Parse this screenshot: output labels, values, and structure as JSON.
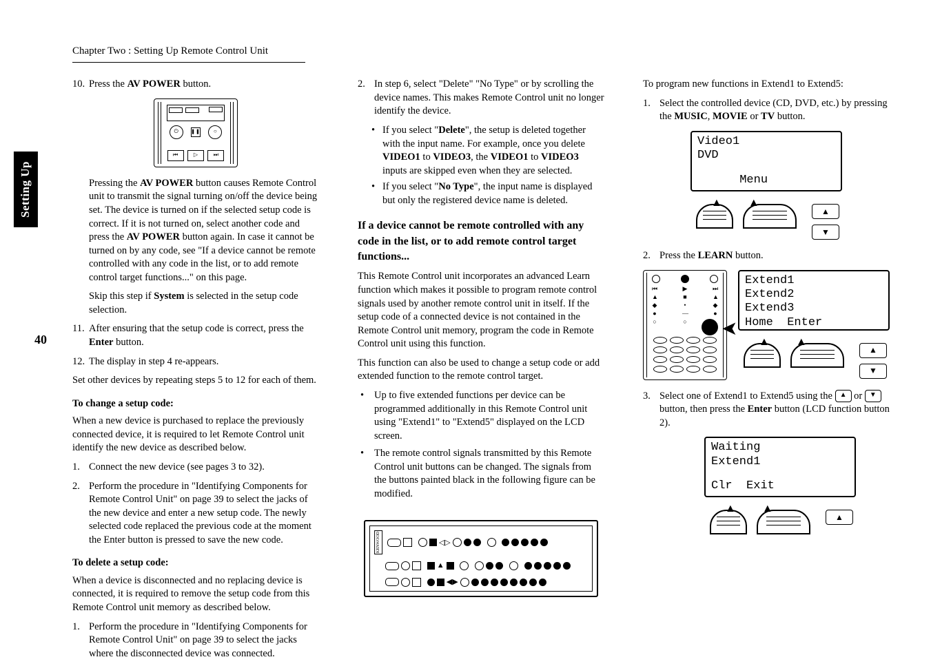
{
  "side_tab": "Setting Up",
  "chapter_header": "Chapter Two : Setting Up Remote Control Unit",
  "page_number": "40",
  "col1": {
    "step10_num": "10.",
    "step10_text_a": "Press the ",
    "step10_bold": "AV POWER",
    "step10_text_b": " button.",
    "para1_a": "Pressing the ",
    "para1_bold1": "AV POWER",
    "para1_b": " button causes Remote Control unit to transmit the signal turning on/off the device being set. The device is turned on if the selected setup code is correct. If it is not turned on, select another code and press the ",
    "para1_bold2": "AV POWER",
    "para1_c": " button again. In case it cannot be turned on by any code, see \"If a device cannot be remote controlled with any code in the list, or to add remote control target functions...\" on this page.",
    "para2_a": "Skip this step if ",
    "para2_bold": "System",
    "para2_b": " is selected in the setup code selection.",
    "step11_num": "11.",
    "step11_a": "After ensuring that the setup code is correct, press the ",
    "step11_bold": "Enter",
    "step11_b": " button.",
    "step12_num": "12.",
    "step12_text": "The display in step 4 re-appears.",
    "para3": "Set other devices by repeating steps 5 to 12 for each of them.",
    "h_change": "To change a setup code:",
    "change_para": "When a new device is purchased to replace the previously connected device, it is required to let Remote Control unit identify the new device as described below.",
    "change_s1_num": "1.",
    "change_s1": "Connect the new device (see pages 3 to 32).",
    "change_s2_num": "2.",
    "change_s2": "Perform the procedure in \"Identifying Components for Remote Control Unit\" on page 39 to select the jacks of the new device and enter a new setup code. The newly selected code replaced the previous code at the moment the Enter button is pressed to save the new code.",
    "h_delete": "To delete a setup code:",
    "delete_para": "When a device is disconnected and no replacing device is connected, it is required to remove the setup code from this Remote Control unit memory as described below.",
    "delete_s1_num": "1.",
    "delete_s1": "Perform the procedure in \"Identifying Components for Remote Control Unit\" on page 39 to select the jacks where the disconnected device was connected."
  },
  "col2": {
    "s2_num": "2.",
    "s2_text": "In step 6, select \"Delete\" \"No Type\" or by scrolling the device names. This makes Remote Control unit no longer identify the device.",
    "b1_a": "If you select \"",
    "b1_bold1": "Delete",
    "b1_b": "\", the setup is deleted together with the input name. For example, once you delete ",
    "b1_bold2": "VIDEO1",
    "b1_c": " to ",
    "b1_bold3": "VIDEO3",
    "b1_d": ", the ",
    "b1_bold4": "VIDEO1",
    "b1_e": " to ",
    "b1_bold5": "VIDEO3",
    "b1_f": " inputs are skipped even when they are selected.",
    "b2_a": "If you select \"",
    "b2_bold": "No Type",
    "b2_b": "\", the input name is displayed but only the registered device name is deleted.",
    "heading": "If a device cannot be remote controlled with any code in the list, or to add remote control target functions...",
    "p1": "This Remote Control unit incorporates an advanced Learn function which makes it possible to program remote control signals used by another remote control unit in itself. If the setup code of a connected device is not contained in the Remote Control unit memory, program the code in Remote Control unit using this function.",
    "p2": "This function can also be used to change a setup code or add extended function to the remote control target.",
    "bl1": "Up to five extended functions per device can be programmed additionally in this Remote Control unit using \"Extend1\" to \"Extend5\" displayed on the LCD screen.",
    "bl2": "The remote control signals transmitted by this Remote Control unit buttons can be changed. The signals from the buttons painted black in the following figure can be modified."
  },
  "col3": {
    "intro": "To program new functions in Extend1 to Extend5:",
    "s1_num": "1.",
    "s1_a": "Select the controlled device (CD, DVD, etc.) by pressing the ",
    "s1_b1": "MUSIC",
    "s1_c": ", ",
    "s1_b2": "MOVIE",
    "s1_d": " or ",
    "s1_b3": "TV",
    "s1_e": " button.",
    "lcd1_top": "Video1\nDVD",
    "lcd1_bot": "      Menu",
    "s2_num": "2.",
    "s2_a": "Press the ",
    "s2_b": "LEARN",
    "s2_c": " button.",
    "lcd2_top": "Extend1\nExtend2\nExtend3",
    "lcd2_bot": "Home  Enter",
    "s3_num": "3.",
    "s3_a": "Select one of Extend1 to Extend5 using the ",
    "s3_b": " or ",
    "s3_c": " button, then press the ",
    "s3_bold": "Enter",
    "s3_d": " button (LCD function button 2).",
    "lcd3_top": "Waiting\nExtend1",
    "lcd3_bot": "Clr  Exit"
  }
}
